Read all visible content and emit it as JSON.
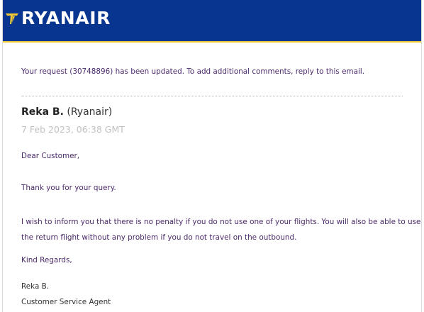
{
  "header": {
    "logo_text": "RYANAIR",
    "logo_icon": "harp-icon",
    "background_color": "#073590",
    "accent_color": "#f1c933"
  },
  "notice": "Your request (30748896) has been updated. To add additional comments, reply to this email.",
  "message": {
    "author_name": "Reka B.",
    "author_org": "(Ryanair)",
    "timestamp": "7 Feb 2023, 06:38 GMT",
    "greeting": "Dear Customer,",
    "thanks": "Thank you for your query.",
    "body_lines": [
      "I wish to inform you that there is no penalty if you do not use one of your flights. You will also be able to use",
      "the return flight without any problem if you do not travel on the outbound."
    ],
    "closing": "Kind Regards,",
    "signature_name": "Reka B.",
    "signature_title": "Customer Service Agent"
  }
}
